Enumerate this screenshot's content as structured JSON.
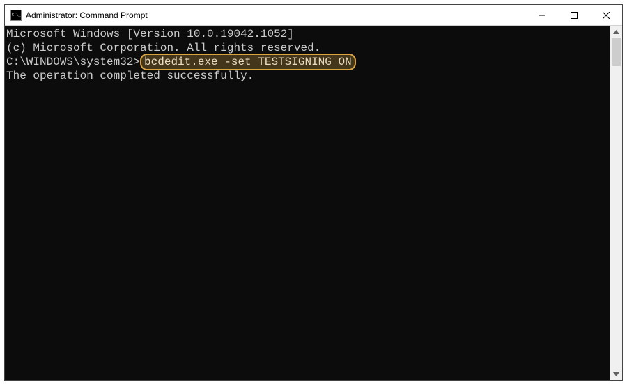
{
  "titlebar": {
    "title": "Administrator: Command Prompt"
  },
  "console": {
    "line1": "Microsoft Windows [Version 10.0.19042.1052]",
    "line2": "(c) Microsoft Corporation. All rights reserved.",
    "blank": "",
    "prompt": "C:\\WINDOWS\\system32>",
    "command": "bcdedit.exe -set TESTSIGNING ON",
    "result": "The operation completed successfully.",
    "trailing": ""
  }
}
